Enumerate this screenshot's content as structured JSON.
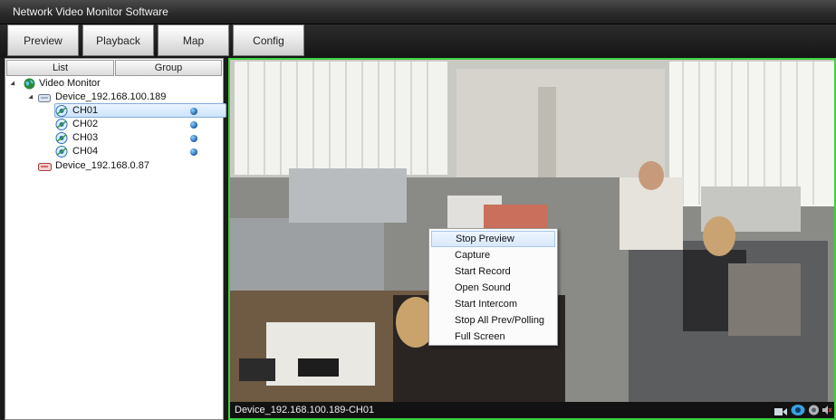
{
  "window": {
    "title": "Network Video Monitor Software"
  },
  "nav": {
    "buttons": [
      "Preview",
      "Playback",
      "Map",
      "Config"
    ]
  },
  "panel": {
    "tabs": [
      "List",
      "Group"
    ]
  },
  "tree": {
    "root": "Video Monitor",
    "device1": "Device_192.168.100.189",
    "channels": [
      "CH01",
      "CH02",
      "CH03",
      "CH04"
    ],
    "device2": "Device_192.168.0.87"
  },
  "video": {
    "status_label": "Device_192.168.100.189-CH01"
  },
  "context_menu": {
    "items": [
      "Stop Preview",
      "Capture",
      "Start Record",
      "Open Sound",
      "Start Intercom",
      "Stop All Prev/Polling",
      "Full Screen"
    ]
  },
  "colors": {
    "selection_border": "#3ecf3e",
    "status_dot": "#1b5aa8"
  }
}
